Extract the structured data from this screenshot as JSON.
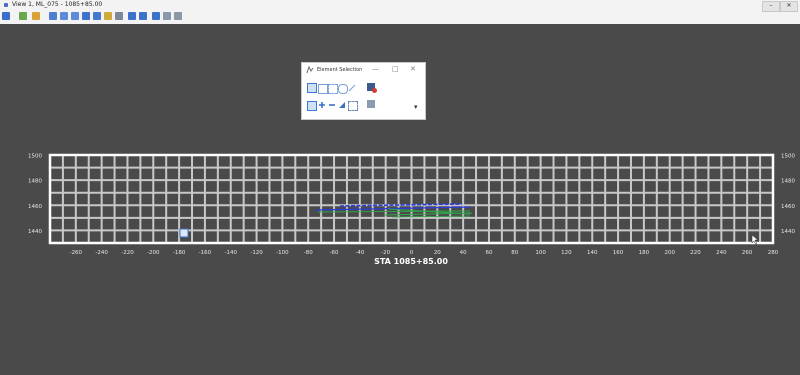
{
  "window": {
    "title": "View 1, ML_075 - 1085+85.00",
    "controls": {
      "minimize": "–",
      "restore": "▭",
      "close": "✕"
    }
  },
  "toolbar": {
    "tools": [
      "view-attributes-icon",
      "levels-icon",
      "display-style-icon",
      "update-view-icon",
      "zoom-in-icon",
      "zoom-out-icon",
      "fit-view-icon",
      "window-area-icon",
      "rotate-view-icon",
      "pan-view-icon",
      "view-previous-icon",
      "view-next-icon",
      "copy-view-icon",
      "camera-icon",
      "clip-volume-icon"
    ]
  },
  "dialog": {
    "title": "Element Selection",
    "controls": {
      "minimize": "—",
      "maximize": "□",
      "close": "✕"
    },
    "dropdown": "▾",
    "tools": [
      "individual-select-icon",
      "block-select-icon",
      "shape-select-icon",
      "line-select-icon",
      "circle-select-icon",
      "add-mode-icon",
      "subtract-mode-icon",
      "invert-mode-icon",
      "clear-mode-icon",
      "filter-icon",
      "deselect-all-icon"
    ]
  },
  "view": {
    "y_ticks": [
      "1500",
      "1480",
      "1460",
      "1440"
    ],
    "x_ticks": [
      "-260",
      "-240",
      "-220",
      "-200",
      "-180",
      "-160",
      "-140",
      "-120",
      "-100",
      "-80",
      "-60",
      "-40",
      "-20",
      "0",
      "20",
      "40",
      "60",
      "80",
      "100",
      "120",
      "140",
      "160",
      "180",
      "200",
      "220",
      "240",
      "260",
      "280"
    ],
    "station_label": "STA 1085+85.00",
    "colors": {
      "background": "#4a4a4a",
      "grid": "#c8c8c8",
      "frame": "#ffffff",
      "profile_blue": "#2c3bdc",
      "profile_green": "#2fa84a"
    }
  }
}
